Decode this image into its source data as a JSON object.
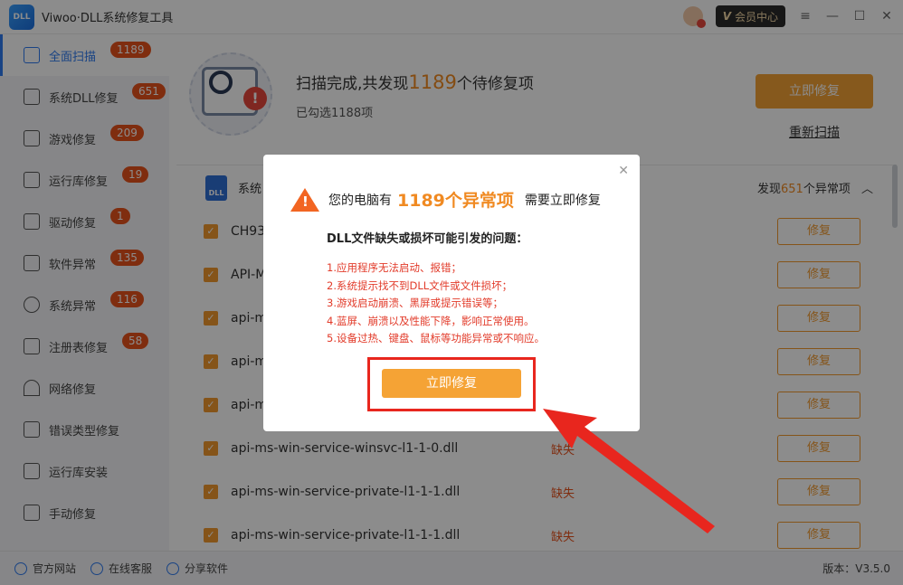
{
  "app": {
    "logo_text": "DLL",
    "title": "Viwoo·DLL系统修复工具"
  },
  "titlebar": {
    "vip_mark": "V",
    "vip_label": "会员中心",
    "menu_icon": "≡",
    "minimize_icon": "—",
    "maximize_icon": "☐",
    "close_icon": "✕"
  },
  "sidebar": {
    "items": [
      {
        "label": "全面扫描",
        "badge": "1189"
      },
      {
        "label": "系统DLL修复",
        "badge": "651"
      },
      {
        "label": "游戏修复",
        "badge": "209"
      },
      {
        "label": "运行库修复",
        "badge": "19"
      },
      {
        "label": "驱动修复",
        "badge": "1"
      },
      {
        "label": "软件异常",
        "badge": "135"
      },
      {
        "label": "系统异常",
        "badge": "116"
      },
      {
        "label": "注册表修复",
        "badge": "58"
      },
      {
        "label": "网络修复",
        "badge": ""
      },
      {
        "label": "错误类型修复",
        "badge": ""
      },
      {
        "label": "运行库安装",
        "badge": ""
      },
      {
        "label": "手动修复",
        "badge": ""
      }
    ]
  },
  "scan": {
    "title_prefix": "扫描完成,共发现",
    "title_count": "1189",
    "title_suffix": "个待修复项",
    "subtitle": "已勾选1188项",
    "fix_now": "立即修复",
    "rescan": "重新扫描"
  },
  "section": {
    "icon_text": "DLL",
    "label": "系统",
    "count_prefix": "发现",
    "count": "651",
    "count_suffix": "个异常项",
    "collapse_icon": "︿"
  },
  "files": [
    {
      "name": "CH93",
      "status": "",
      "action": "修复"
    },
    {
      "name": "API-M",
      "status": "",
      "action": "修复"
    },
    {
      "name": "api-m",
      "status": "",
      "action": "修复"
    },
    {
      "name": "api-m",
      "status": "",
      "action": "修复"
    },
    {
      "name": "api-m",
      "status": "",
      "action": "修复"
    },
    {
      "name": "api-ms-win-service-winsvc-l1-1-0.dll",
      "status": "缺失",
      "action": "修复"
    },
    {
      "name": "api-ms-win-service-private-l1-1-1.dll",
      "status": "缺失",
      "action": "修复"
    },
    {
      "name": "api-ms-win-service-private-l1-1-1.dll",
      "status": "缺失",
      "action": "修复"
    }
  ],
  "footer": {
    "website": "官方网站",
    "support": "在线客服",
    "share": "分享软件",
    "version": "版本：V3.5.0"
  },
  "dialog": {
    "head_prefix": "您的电脑有",
    "head_count": "1189个异常项",
    "head_suffix": "需要立即修复",
    "subtitle": "DLL文件缺失或损坏可能引发的问题：",
    "issues": [
      "1.应用程序无法启动、报错；",
      "2.系统提示找不到DLL文件或文件损坏；",
      "3.游戏启动崩溃、黑屏或提示错误等；",
      "4.蓝屏、崩溃以及性能下降，影响正常使用。",
      "5.设备过热、键盘、鼠标等功能异常或不响应。"
    ],
    "fix_button": "立即修复",
    "close_icon": "✕"
  },
  "colors": {
    "accent": "#2f7bf0",
    "orange": "#f5a335",
    "badge": "#e8521d",
    "highlight": "#e8261e"
  }
}
